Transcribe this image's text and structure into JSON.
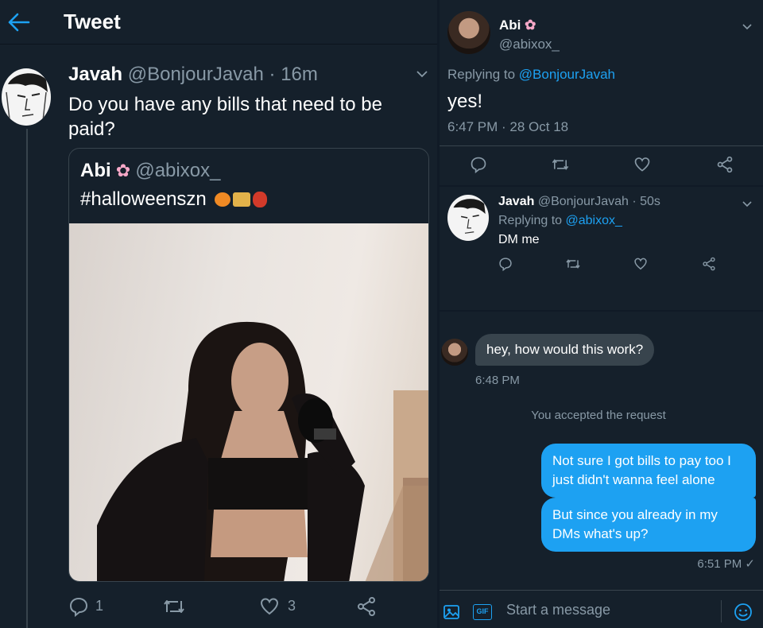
{
  "left": {
    "header_title": "Tweet",
    "tweet": {
      "name": "Javah",
      "handle": "@BonjourJavah",
      "time": "· 16m",
      "text": "Do you have any bills that need to be paid?",
      "quote": {
        "name": "Abi",
        "handle": "@abixox_",
        "text": "#halloweenszn"
      },
      "replies": "1",
      "likes": "3"
    }
  },
  "right_top": {
    "name": "Abi",
    "handle": "@abixox_",
    "replying_prefix": "Replying to ",
    "replying_to": "@BonjourJavah",
    "text": "yes!",
    "timestamp": "6:47 PM · 28 Oct 18"
  },
  "right_reply": {
    "name": "Javah",
    "handle_time": "@BonjourJavah · 50s",
    "replying_prefix": "Replying to ",
    "replying_to": "@abixox_",
    "text": "DM me"
  },
  "dm": {
    "incoming": "hey, how would this work?",
    "incoming_time": "6:48 PM",
    "system": "You accepted the request",
    "outgoing_1": "Not sure I got bills to pay too I just didn't wanna feel alone",
    "outgoing_2": "But since you already in my DMs what's up?",
    "outgoing_time": "6:51 PM ✓",
    "composer_placeholder": "Start a message",
    "gif_label": "GIF"
  },
  "colors": {
    "background": "#15202b",
    "accent": "#1da1f2",
    "muted": "#8899a6",
    "incoming_bubble": "#38444d"
  }
}
